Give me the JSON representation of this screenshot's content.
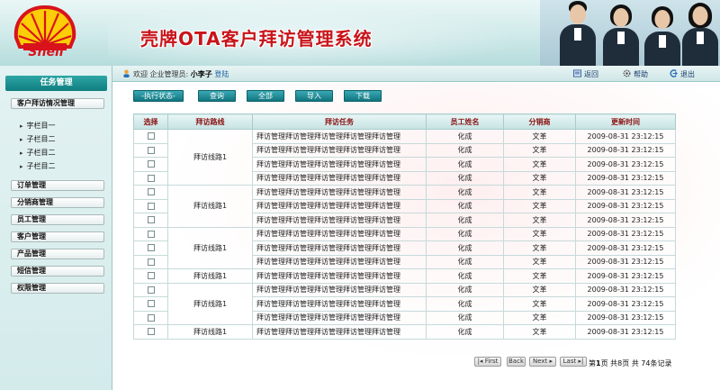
{
  "brand": {
    "logo_text": "Shell",
    "logo_red": "#d8131c",
    "logo_yellow": "#fbce07"
  },
  "app_title": "壳牌OTA客户拜访管理系统",
  "topbar": {
    "welcome": "欢迎 企业管理员:",
    "username": "小李子",
    "login_link": "登陆",
    "back": "返回",
    "help": "帮助",
    "exit": "退出"
  },
  "sidebar": {
    "header": "任务管理",
    "open_item": "客户拜访情况管理",
    "sub_items": [
      "字栏目一",
      "子栏目二",
      "子栏目二",
      "子栏目二"
    ],
    "items": [
      "订单管理",
      "分销商管理",
      "员工管理",
      "客户管理",
      "产品管理",
      "短信管理",
      "权限管理"
    ]
  },
  "actions": {
    "status": "-执行状态-",
    "query": "查询",
    "all": "全部",
    "import": "导入",
    "download": "下载"
  },
  "table": {
    "headers": [
      "选择",
      "拜访路线",
      "拜访任务",
      "员工姓名",
      "分销商",
      "更新时间"
    ],
    "groups": [
      {
        "route": "拜访线路1",
        "rows": 4
      },
      {
        "route": "拜访线路1",
        "rows": 3
      },
      {
        "route": "拜访线路1",
        "rows": 3
      },
      {
        "route": "拜访线路1",
        "rows": 1
      },
      {
        "route": "拜访线路1",
        "rows": 3
      },
      {
        "route": "拜访线路1",
        "rows": 1
      }
    ],
    "row": {
      "task": "拜访管理拜访管理拜访管理拜访管理拜访管理",
      "employee": "化成",
      "distributor": "文革",
      "updated": "2009-08-31 23:12:15"
    }
  },
  "pager": {
    "first": "First",
    "back": "Back",
    "next": "Next",
    "last": "Last",
    "info_prefix": "第",
    "page": "1",
    "info_mid": "页 共8页 共 74条记录"
  },
  "colors": {
    "accent": "#0f7d7f",
    "header_text": "#8a1010",
    "title_red": "#c8141a"
  }
}
